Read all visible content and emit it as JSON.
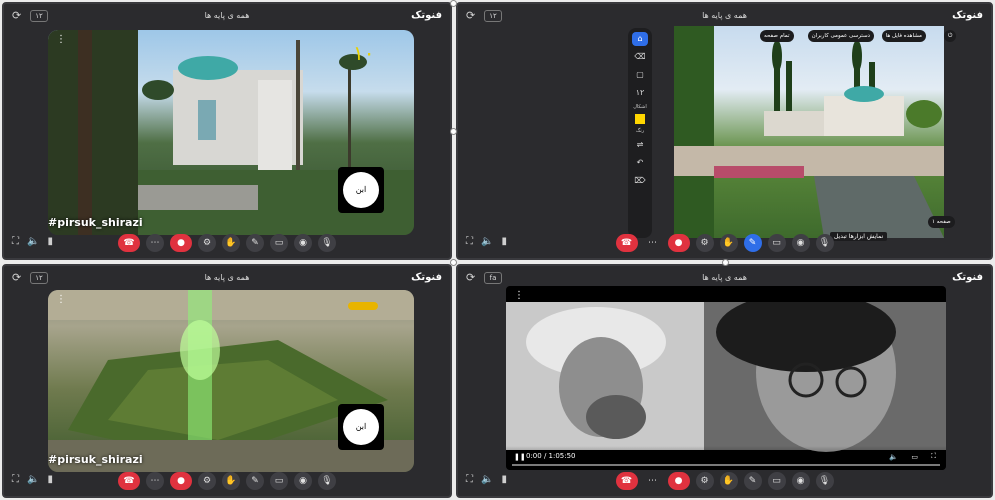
{
  "panels": [
    {
      "brand": "فنوتک",
      "title": "همه ی پایه ها",
      "tag": "۱۲",
      "hashtag": "#pirsuk_shirazi",
      "watermark": "۱۰"
    },
    {
      "brand": "فنوتک",
      "title": "همه ی پایه ها",
      "tag": "۱۲",
      "pills": {
        "pdf": "مشاهده فایل ها",
        "share": "دسترسی عمومی کاربران",
        "fullscreen": "تمام صفحه",
        "page": "صفحه ۱"
      },
      "tooltip": "نمایش ابزارها تبدیل",
      "side_labels": {
        "size": "۱۲",
        "shape": "اشکال",
        "color": "رنگ"
      }
    },
    {
      "brand": "فنوتک",
      "title": "همه ی پایه ها",
      "tag": "۱۲",
      "hashtag": "#pirsuk_shirazi"
    },
    {
      "brand": "فنوتک",
      "title": "همه ی پایه ها",
      "tag": "fa",
      "time": "0:00 / 1:05:50"
    }
  ],
  "colors": {
    "accent": "#2f6ee8",
    "end_call": "#e0323f",
    "panel_bg": "#2b2b2e"
  },
  "icons": [
    "refresh-icon",
    "more-icon",
    "mic-icon",
    "camera-icon",
    "hand-icon",
    "pen-icon",
    "screen-share-icon",
    "settings-icon"
  ]
}
